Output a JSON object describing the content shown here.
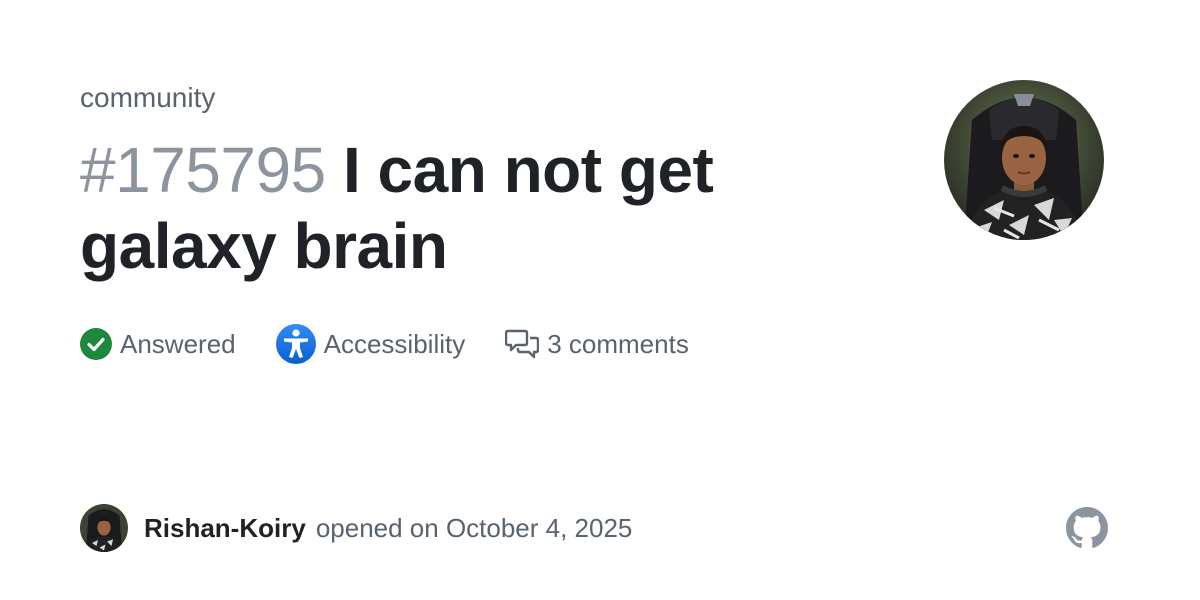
{
  "repo": {
    "name": "community"
  },
  "discussion": {
    "number": "#175795",
    "title": "I can not get galaxy brain"
  },
  "meta": {
    "status": {
      "label": "Answered",
      "icon": "check-circle-icon",
      "color": "#1f883d"
    },
    "category": {
      "label": "Accessibility",
      "icon": "accessibility-icon",
      "color": "#0969da"
    },
    "comments": {
      "label": "3 comments",
      "icon": "comment-discussion-icon"
    }
  },
  "footer": {
    "author": "Rishan-Koiry",
    "opened_text": "opened on October 4, 2025"
  },
  "icons": {
    "avatar": "user-avatar",
    "logo": "github-mark-icon"
  }
}
